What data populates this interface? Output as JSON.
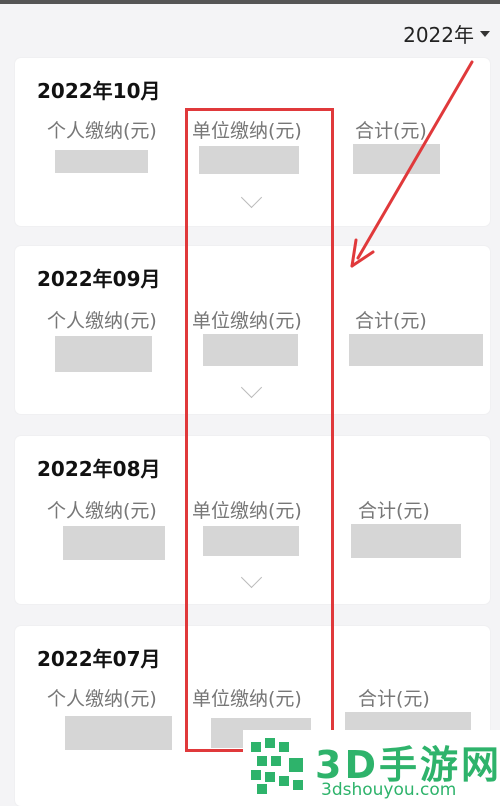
{
  "header": {
    "year_selector": "2022年",
    "caret_icon": "caret-down-icon"
  },
  "columns": {
    "personal": "个人缴纳(元)",
    "employer": "单位缴纳(元)",
    "total": "合计(元)"
  },
  "records": [
    {
      "month": "2022年10月",
      "values_visible": false
    },
    {
      "month": "2022年09月",
      "values_visible": false
    },
    {
      "month": "2022年08月",
      "values_visible": false
    },
    {
      "month": "2022年07月",
      "values_visible": false
    }
  ],
  "annotation": {
    "color": "#e0393b"
  },
  "watermark": {
    "title": "3D手游网",
    "url": "3dshouyou.com",
    "color": "#2eb36b"
  }
}
